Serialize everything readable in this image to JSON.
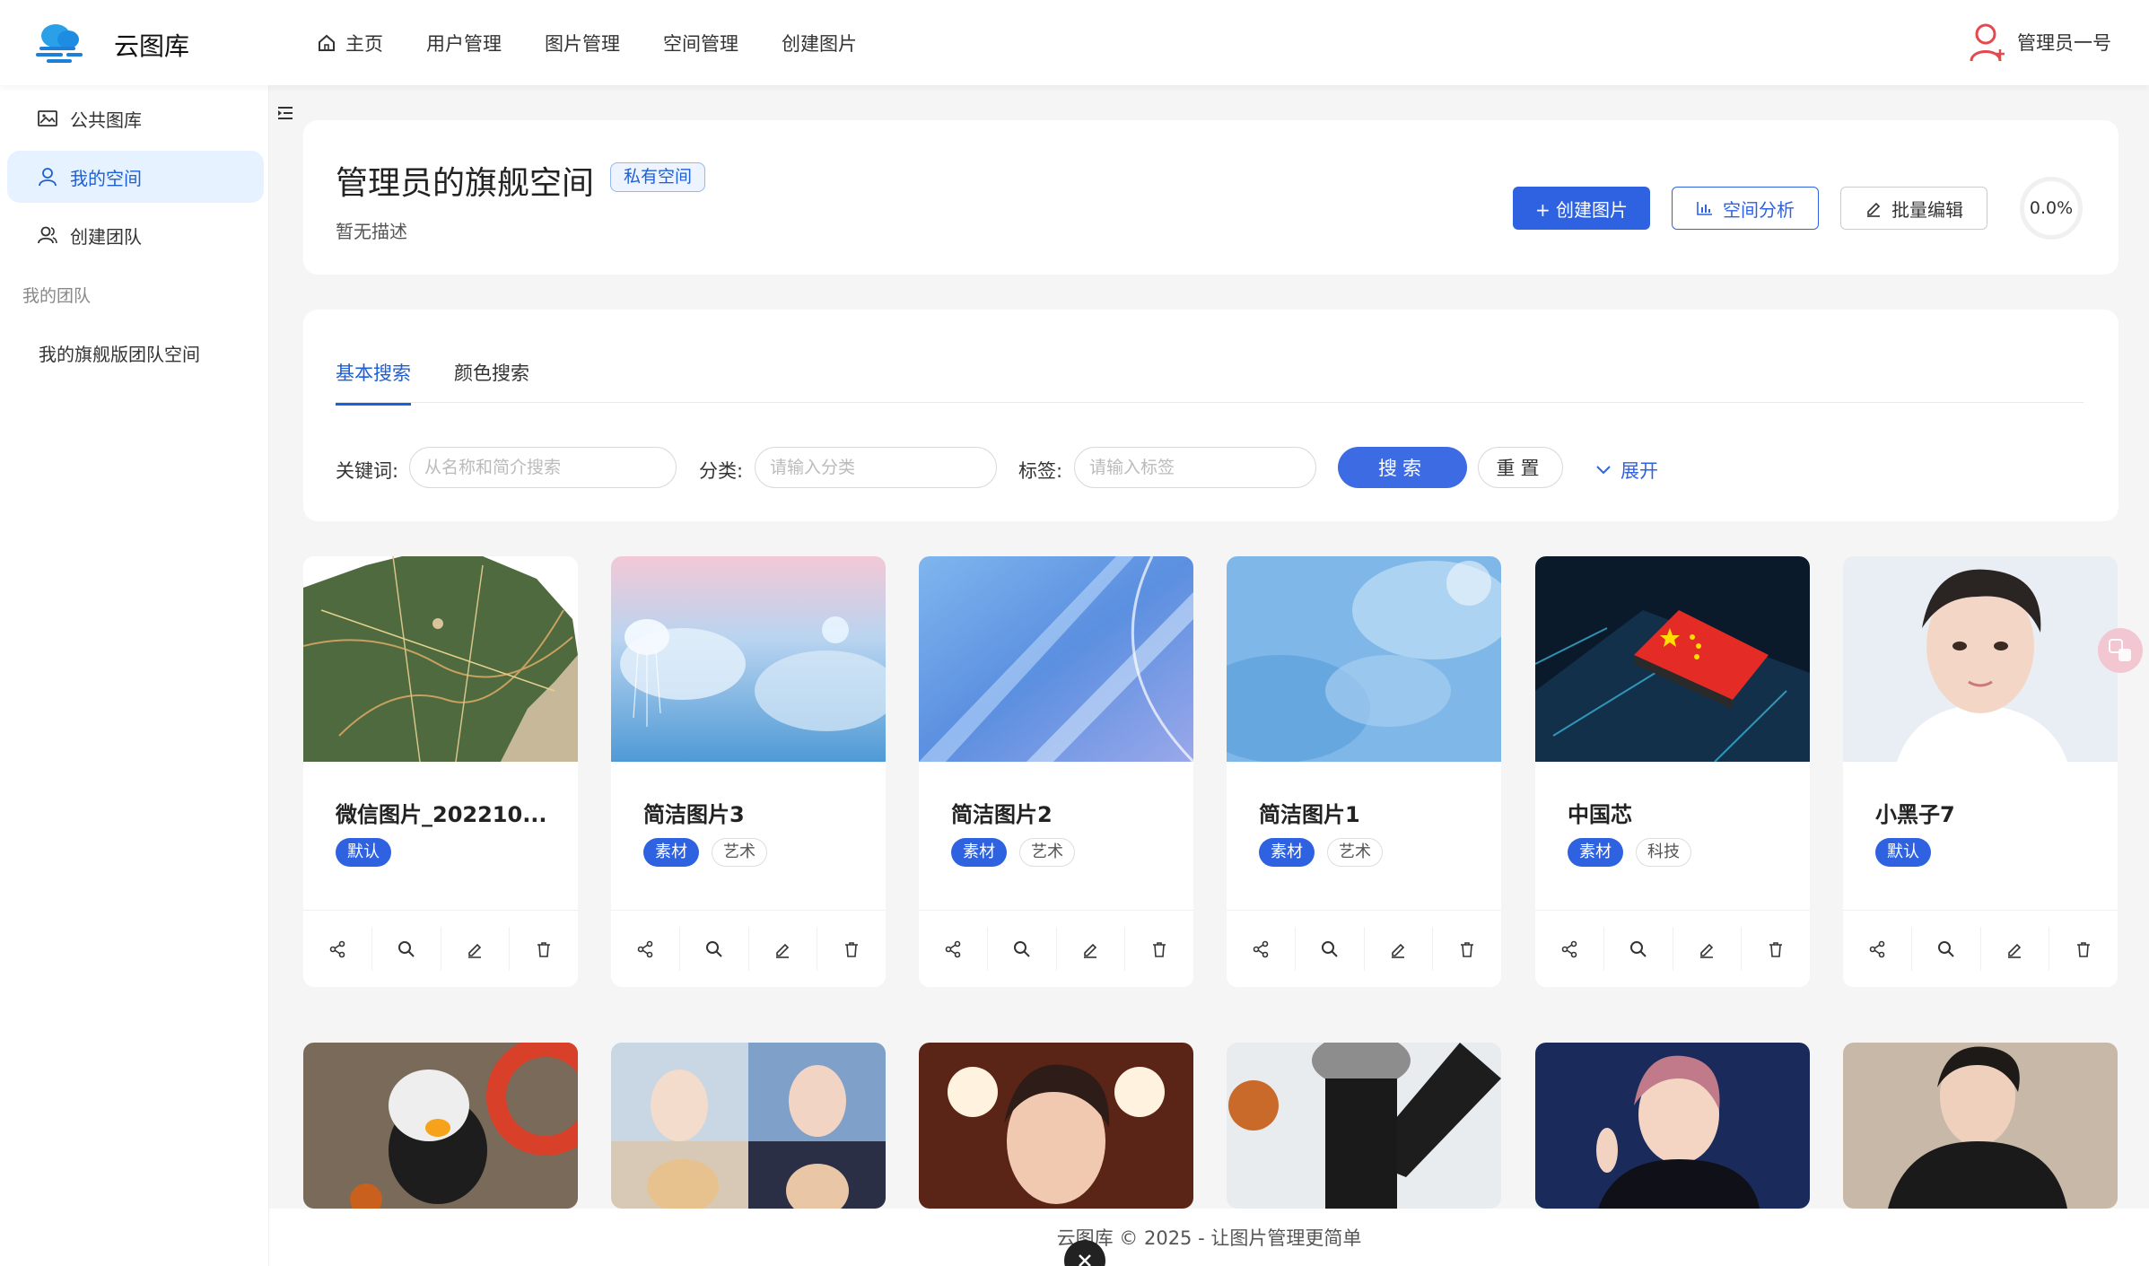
{
  "header": {
    "brand": "云图库",
    "nav": [
      {
        "label": "主页",
        "icon": "home-icon"
      },
      {
        "label": "用户管理"
      },
      {
        "label": "图片管理"
      },
      {
        "label": "空间管理"
      },
      {
        "label": "创建图片"
      }
    ],
    "user_name": "管理员一号"
  },
  "sidebar": {
    "items": [
      {
        "label": "公共图库",
        "icon": "image-icon"
      },
      {
        "label": "我的空间",
        "icon": "user-icon",
        "active": true
      },
      {
        "label": "创建团队",
        "icon": "team-icon"
      }
    ],
    "group_title": "我的团队",
    "teams": [
      "我的旗舰版团队空间"
    ]
  },
  "space": {
    "title": "管理员的旗舰空间",
    "tag": "私有空间",
    "description": "暂无描述",
    "create_btn": "+ 创建图片",
    "analyze_btn": "空间分析",
    "batch_btn": "批量编辑",
    "usage": "0.0%"
  },
  "search": {
    "tabs": [
      "基本搜索",
      "颜色搜索"
    ],
    "keyword_label": "关键词:",
    "keyword_placeholder": "从名称和简介搜索",
    "category_label": "分类:",
    "category_placeholder": "请输入分类",
    "tag_label": "标签:",
    "tag_placeholder": "请输入标签",
    "search_btn": "搜索",
    "reset_btn": "重置",
    "expand": "展开"
  },
  "pictures": [
    {
      "name": "微信图片_202210...",
      "tags": [
        "默认"
      ],
      "grey_tags": []
    },
    {
      "name": "简洁图片3",
      "tags": [
        "素材"
      ],
      "grey_tags": [
        "艺术"
      ]
    },
    {
      "name": "简洁图片2",
      "tags": [
        "素材"
      ],
      "grey_tags": [
        "艺术"
      ]
    },
    {
      "name": "简洁图片1",
      "tags": [
        "素材"
      ],
      "grey_tags": [
        "艺术"
      ]
    },
    {
      "name": "中国芯",
      "tags": [
        "素材"
      ],
      "grey_tags": [
        "科技"
      ]
    },
    {
      "name": "小黑子7",
      "tags": [
        "默认"
      ],
      "grey_tags": []
    }
  ],
  "footer": {
    "text": "云图库 © 2025 - 让图片管理更简单"
  },
  "colors": {
    "primary": "#2f62e0",
    "active_bg": "#e6f2ff",
    "page_bg": "#f5f5f5"
  }
}
